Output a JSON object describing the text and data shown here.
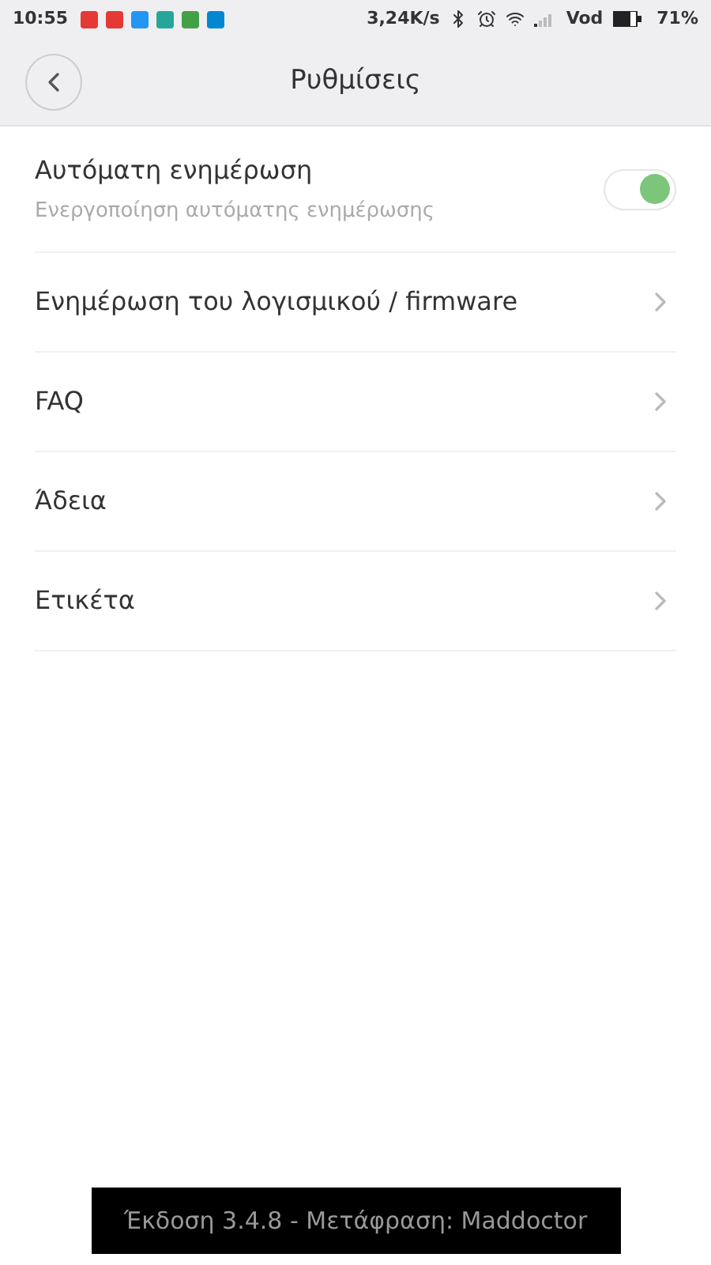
{
  "status_bar": {
    "time": "10:55",
    "speed": "3,24K/s",
    "carrier": "Vod",
    "battery": "71%"
  },
  "header": {
    "title": "Ρυθμίσεις"
  },
  "items": [
    {
      "kind": "toggle",
      "label": "Αυτόματη ενημέρωση",
      "subtitle": "Ενεργοποίηση αυτόματης ενημέρωσης",
      "on": true
    },
    {
      "kind": "link",
      "label": "Ενημέρωση του λογισμικού / firmware"
    },
    {
      "kind": "link",
      "label": "FAQ"
    },
    {
      "kind": "link",
      "label": "Άδεια"
    },
    {
      "kind": "link",
      "label": "Ετικέτα"
    }
  ],
  "toast": "Έκδοση 3.4.8 - Μετάφραση: Maddoctor"
}
